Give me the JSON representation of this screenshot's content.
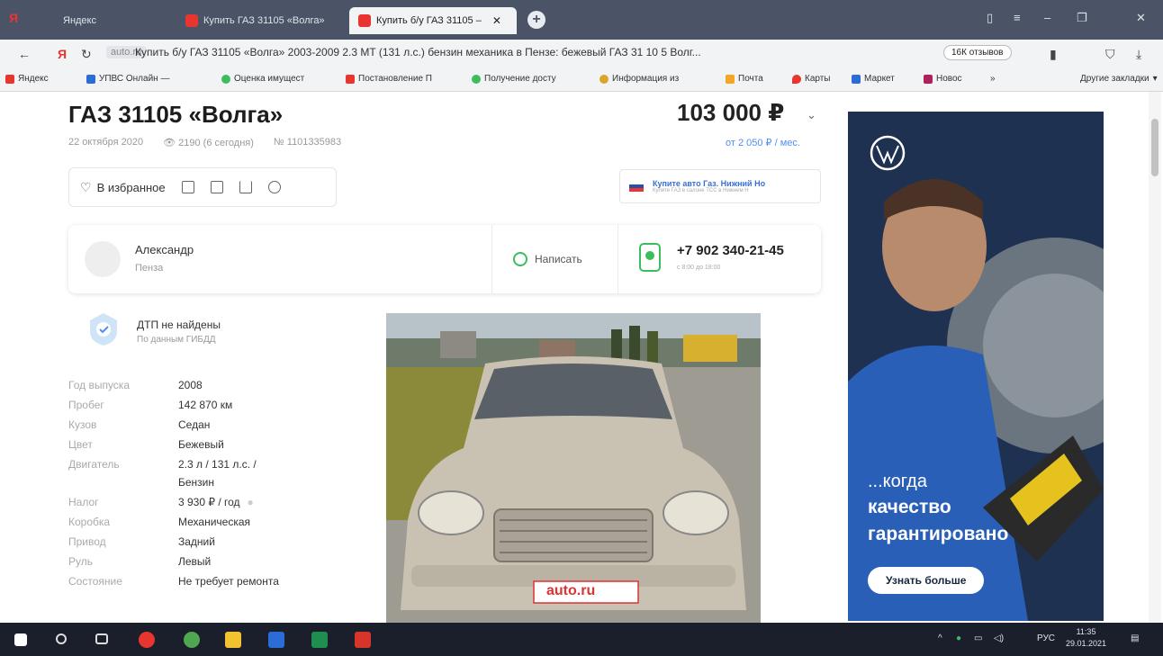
{
  "browser": {
    "tabs": [
      {
        "label": "Яндекс"
      },
      {
        "label": "Купить ГАЗ 31105 «Волга»"
      },
      {
        "label": "Купить б/у ГАЗ 31105 –"
      }
    ],
    "domain": "auto.ru",
    "address": "Купить б/у ГАЗ 31105 «Волга» 2003-2009 2.3 MT (131 л.с.) бензин механика в Пензе: бежевый ГАЗ 31 10 5 Волг...",
    "reviews": "16К отзывов",
    "bookmarks": [
      {
        "label": "Яндекс",
        "color": "#e8352f"
      },
      {
        "label": "УПВС Онлайн — ",
        "color": "#2b6cd6"
      },
      {
        "label": "Оценка имущест",
        "color": "#3dbd5d"
      },
      {
        "label": "Постановление П",
        "color": "#e8352f"
      },
      {
        "label": "Получение досту",
        "color": "#3dbd5d"
      },
      {
        "label": "Информация из",
        "color": "#d8a62b"
      },
      {
        "label": "Почта",
        "color": "#f5a623"
      },
      {
        "label": "Карты",
        "color": "#e8352f"
      },
      {
        "label": "Маркет",
        "color": "#f5c623"
      },
      {
        "label": "Новос",
        "color": "#b0205a"
      }
    ],
    "other_bookmarks": "Другие закладки"
  },
  "listing": {
    "title": "ГАЗ 31105 «Волга»",
    "price": "103 000 ₽",
    "date": "22 октября 2020",
    "views": "2190 (6 сегодня)",
    "number": "№ 1101335983",
    "credit": "от 2 050 ₽ / мес.",
    "favorite_label": "В избранное",
    "ad_title": "Купите авто Газ. Нижний Но",
    "ad_sub": "Купите ГАЗ в салоне ТСС в Нижнем Н",
    "seller_name": "Александр",
    "seller_city": "Пенза",
    "write_label": "Написать",
    "phone": "+7 902 340-21-45",
    "phone_sub": "с 8:00 до 18:00",
    "dtp_title": "ДТП не найдены",
    "dtp_sub": "По данным ГИБДД",
    "specs": [
      {
        "k": "Год выпуска",
        "v": "2008"
      },
      {
        "k": "Пробег",
        "v": "142 870 км"
      },
      {
        "k": "Кузов",
        "v": "Седан"
      },
      {
        "k": "Цвет",
        "v": "Бежевый"
      },
      {
        "k": "Двигатель",
        "v": "2.3 л / 131 л.с. / Бензин"
      },
      {
        "k": "Налог",
        "v": "3 930 ₽ / год"
      },
      {
        "k": "Коробка",
        "v": "Механическая"
      },
      {
        "k": "Привод",
        "v": "Задний"
      },
      {
        "k": "Руль",
        "v": "Левый"
      },
      {
        "k": "Состояние",
        "v": "Не требует ремонта"
      }
    ],
    "watermark": "auto.ru"
  },
  "banner": {
    "line1": "...когда",
    "line2": "качество",
    "line3": "гарантировано",
    "button": "Узнать больше"
  },
  "taskbar": {
    "lang": "РУС",
    "time": "11:35",
    "date": "29.01.2021"
  }
}
